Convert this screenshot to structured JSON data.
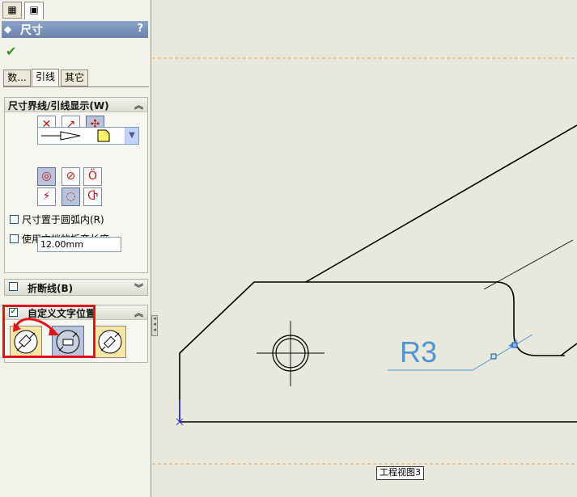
{
  "panel": {
    "tabs": [
      {
        "icon": "feature-tree-icon",
        "glyph": "▦"
      },
      {
        "icon": "property-manager-icon",
        "glyph": "▣"
      }
    ],
    "title": "尺寸",
    "help": "?",
    "ok_glyph": "✔",
    "subtabs": [
      "数...",
      "引线",
      "其它"
    ],
    "active_subtab": 1
  },
  "leader_group": {
    "title": "尺寸界线/引线显示(W)",
    "chevron": "︽",
    "arrow_position_icons": [
      "arrows-outside-icon",
      "arrows-inside-icon",
      "smart-arrows-icon"
    ],
    "radius_icons": [
      "radius-icon",
      "diameter-icon",
      "linear-icon",
      "foreshortened-icon",
      "radius-selected-icon",
      "diameter-alt-icon"
    ],
    "inside_arc_label": "尺寸置于圆弧内(R)",
    "doc_bend_label": "使用文档的折弯长度",
    "bend_length": "12.00mm"
  },
  "break_group": {
    "title": "折断线(B)",
    "chevron": "︾"
  },
  "text_pos_group": {
    "title": "自定义文字位置",
    "chevron": "︽",
    "checked": true,
    "options": [
      "solid-leader-aligned-text-icon",
      "broken-leader-horizontal-text-icon",
      "broken-leader-aligned-text-icon"
    ],
    "selected_option": 1
  },
  "drawing": {
    "dimension_text": "R3",
    "view_label": "工程视图3"
  },
  "colors": {
    "accent_red": "#e0151a",
    "dimension_blue": "#4f94d4",
    "sheet_bg": "#e9e8dd",
    "border_dashed": "#e8a24a"
  }
}
